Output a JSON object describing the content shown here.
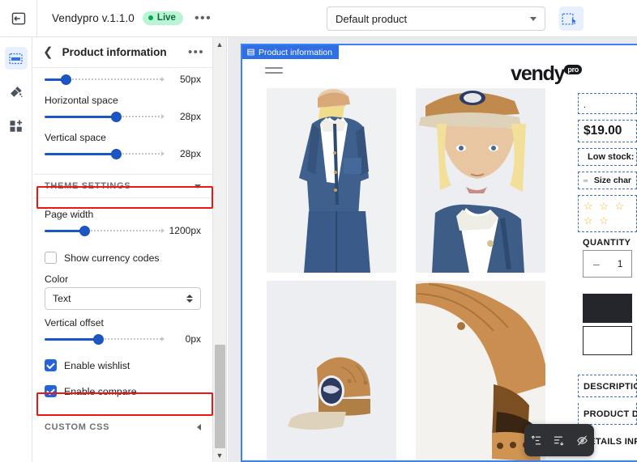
{
  "topbar": {
    "back_icon": "back-arrow-icon",
    "app_title": "Vendypro v.1.1.0",
    "live_badge": "Live",
    "more_label": "•••",
    "product_select_value": "Default product",
    "inspect_icon": "select-inspect-icon"
  },
  "rail": {
    "items": [
      {
        "name": "sections-icon",
        "label": "Sections",
        "active": true
      },
      {
        "name": "theme-brush-icon",
        "label": "Theme design",
        "active": false
      },
      {
        "name": "add-blocks-icon",
        "label": "Apps",
        "active": false
      }
    ]
  },
  "panel": {
    "back_icon": "chevron-left-icon",
    "title": "Product information",
    "more_label": "•••",
    "sliders_top": [
      {
        "label": "",
        "value": "50px",
        "pct": 18
      },
      {
        "label": "Horizontal space",
        "value": "28px",
        "pct": 60
      },
      {
        "label": "Vertical space",
        "value": "28px",
        "pct": 60
      }
    ],
    "theme_settings": {
      "heading": "THEME SETTINGS",
      "collapse_icon": "chevron-down-icon",
      "page_width": {
        "label": "Page width",
        "value": "1200px",
        "pct": 33
      },
      "show_currency_codes": {
        "label": "Show currency codes",
        "checked": false
      },
      "color": {
        "label": "Color",
        "value": "Text"
      },
      "vertical_offset": {
        "label": "Vertical offset",
        "value": "0px",
        "pct": 45
      },
      "enable_wishlist": {
        "label": "Enable wishlist",
        "checked": true
      },
      "enable_compare": {
        "label": "Enable compare",
        "checked": true
      }
    },
    "custom_css": {
      "heading": "CUSTOM CSS",
      "collapse_icon": "chevron-left-icon"
    },
    "scroll_up_icon": "scroll-up-arrow-icon",
    "scroll_down_icon": "scroll-down-arrow-icon"
  },
  "highlights": {
    "color": "#f01414",
    "boxes": [
      "theme-settings-header",
      "enable-compare-row"
    ]
  },
  "preview": {
    "section_badge": {
      "icon": "section-icon",
      "label": "Product information"
    },
    "brand": {
      "word": "vendy",
      "sup": "pro"
    },
    "menu_icon": "hamburger-menu-icon",
    "gallery": [
      {
        "name": "product-image-model-denim-jacket"
      },
      {
        "name": "product-image-model-cap-portrait"
      },
      {
        "name": "product-image-cap-side"
      },
      {
        "name": "product-image-cap-back"
      }
    ],
    "product": {
      "title_placeholder": ".",
      "price": "$19.00",
      "stock_icon": "clock-icon",
      "stock_text": "Low stock:",
      "sizechart_icon": "ruler-icon",
      "sizechart_text": "Size char",
      "stars": "☆ ☆ ☆ ☆ ☆",
      "quantity_label": "QUANTITY",
      "quantity_minus": "–",
      "quantity_value": "1",
      "description_label": "DESCRIPTION",
      "product_details_label": "PRODUCT DE",
      "details_info_label": "DETAILS INFO"
    },
    "float_toolbar": [
      {
        "name": "move-block-up-icon"
      },
      {
        "name": "move-block-down-icon"
      },
      {
        "name": "hide-block-icon"
      }
    ]
  }
}
